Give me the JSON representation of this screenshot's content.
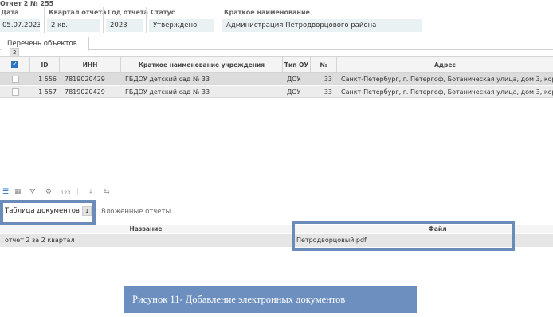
{
  "report": {
    "title": "Отчет 2 № 255"
  },
  "fields": [
    {
      "label": "Дата",
      "value": "05.07.2023"
    },
    {
      "label": "Квартал отчета",
      "value": "2 кв."
    },
    {
      "label": "Год отчета",
      "value": "2023"
    },
    {
      "label": "Статус",
      "value": "Утверждено"
    },
    {
      "label": "Краткое наименование",
      "value": "Администрация Петродворцового района"
    }
  ],
  "tabs": [
    {
      "label": "Перечень объектов",
      "count": "2"
    }
  ],
  "objects_table": {
    "headers": {
      "id": "ID",
      "inn": "ИНН",
      "name": "Краткое наименование учреждения",
      "type": "Тип ОУ",
      "num": "№",
      "address": "Адрес"
    },
    "rows": [
      {
        "id": "1 556",
        "inn": "7819020429",
        "name": "ГБДОУ детский сад № 33",
        "type": "ДОУ",
        "num": "33",
        "address": "Санкт-Петербург, г. Петергоф, Ботаническая улица, дом 3, кор"
      },
      {
        "id": "1 557",
        "inn": "7819020429",
        "name": "ГБДОУ детский сад № 33",
        "type": "ДОУ",
        "num": "33",
        "address": "Санкт-Петербург, г. Петергоф, Ботаническая улица, дом 3, кор"
      }
    ]
  },
  "toolbar": {
    "digits_label": "123"
  },
  "lower_tabs": [
    {
      "label": "Таблица документов",
      "count": "1"
    },
    {
      "label": "Вложенные отчеты"
    }
  ],
  "documents_table": {
    "headers": {
      "name": "Название",
      "file": "Файл"
    },
    "rows": [
      {
        "name": "отчет 2 за 2 квартал",
        "file": "Петродворцовый.pdf"
      }
    ]
  },
  "caption": "Рисунок 11- Добавление электронных документов",
  "colors": {
    "highlight": "#6b8bba",
    "caption_bg": "#6d8fbf",
    "checkbox": "#2b74c2"
  }
}
